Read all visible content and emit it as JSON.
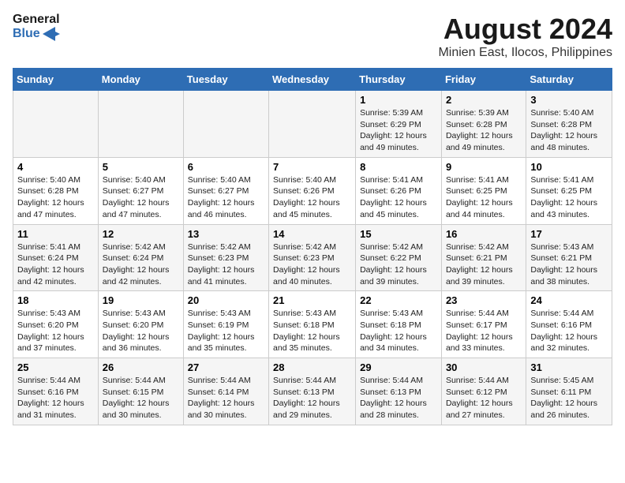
{
  "logo": {
    "text_general": "General",
    "text_blue": "Blue"
  },
  "title": "August 2024",
  "subtitle": "Minien East, Ilocos, Philippines",
  "days_of_week": [
    "Sunday",
    "Monday",
    "Tuesday",
    "Wednesday",
    "Thursday",
    "Friday",
    "Saturday"
  ],
  "weeks": [
    [
      {
        "num": "",
        "info": ""
      },
      {
        "num": "",
        "info": ""
      },
      {
        "num": "",
        "info": ""
      },
      {
        "num": "",
        "info": ""
      },
      {
        "num": "1",
        "info": "Sunrise: 5:39 AM\nSunset: 6:29 PM\nDaylight: 12 hours\nand 49 minutes."
      },
      {
        "num": "2",
        "info": "Sunrise: 5:39 AM\nSunset: 6:28 PM\nDaylight: 12 hours\nand 49 minutes."
      },
      {
        "num": "3",
        "info": "Sunrise: 5:40 AM\nSunset: 6:28 PM\nDaylight: 12 hours\nand 48 minutes."
      }
    ],
    [
      {
        "num": "4",
        "info": "Sunrise: 5:40 AM\nSunset: 6:28 PM\nDaylight: 12 hours\nand 47 minutes."
      },
      {
        "num": "5",
        "info": "Sunrise: 5:40 AM\nSunset: 6:27 PM\nDaylight: 12 hours\nand 47 minutes."
      },
      {
        "num": "6",
        "info": "Sunrise: 5:40 AM\nSunset: 6:27 PM\nDaylight: 12 hours\nand 46 minutes."
      },
      {
        "num": "7",
        "info": "Sunrise: 5:40 AM\nSunset: 6:26 PM\nDaylight: 12 hours\nand 45 minutes."
      },
      {
        "num": "8",
        "info": "Sunrise: 5:41 AM\nSunset: 6:26 PM\nDaylight: 12 hours\nand 45 minutes."
      },
      {
        "num": "9",
        "info": "Sunrise: 5:41 AM\nSunset: 6:25 PM\nDaylight: 12 hours\nand 44 minutes."
      },
      {
        "num": "10",
        "info": "Sunrise: 5:41 AM\nSunset: 6:25 PM\nDaylight: 12 hours\nand 43 minutes."
      }
    ],
    [
      {
        "num": "11",
        "info": "Sunrise: 5:41 AM\nSunset: 6:24 PM\nDaylight: 12 hours\nand 42 minutes."
      },
      {
        "num": "12",
        "info": "Sunrise: 5:42 AM\nSunset: 6:24 PM\nDaylight: 12 hours\nand 42 minutes."
      },
      {
        "num": "13",
        "info": "Sunrise: 5:42 AM\nSunset: 6:23 PM\nDaylight: 12 hours\nand 41 minutes."
      },
      {
        "num": "14",
        "info": "Sunrise: 5:42 AM\nSunset: 6:23 PM\nDaylight: 12 hours\nand 40 minutes."
      },
      {
        "num": "15",
        "info": "Sunrise: 5:42 AM\nSunset: 6:22 PM\nDaylight: 12 hours\nand 39 minutes."
      },
      {
        "num": "16",
        "info": "Sunrise: 5:42 AM\nSunset: 6:21 PM\nDaylight: 12 hours\nand 39 minutes."
      },
      {
        "num": "17",
        "info": "Sunrise: 5:43 AM\nSunset: 6:21 PM\nDaylight: 12 hours\nand 38 minutes."
      }
    ],
    [
      {
        "num": "18",
        "info": "Sunrise: 5:43 AM\nSunset: 6:20 PM\nDaylight: 12 hours\nand 37 minutes."
      },
      {
        "num": "19",
        "info": "Sunrise: 5:43 AM\nSunset: 6:20 PM\nDaylight: 12 hours\nand 36 minutes."
      },
      {
        "num": "20",
        "info": "Sunrise: 5:43 AM\nSunset: 6:19 PM\nDaylight: 12 hours\nand 35 minutes."
      },
      {
        "num": "21",
        "info": "Sunrise: 5:43 AM\nSunset: 6:18 PM\nDaylight: 12 hours\nand 35 minutes."
      },
      {
        "num": "22",
        "info": "Sunrise: 5:43 AM\nSunset: 6:18 PM\nDaylight: 12 hours\nand 34 minutes."
      },
      {
        "num": "23",
        "info": "Sunrise: 5:44 AM\nSunset: 6:17 PM\nDaylight: 12 hours\nand 33 minutes."
      },
      {
        "num": "24",
        "info": "Sunrise: 5:44 AM\nSunset: 6:16 PM\nDaylight: 12 hours\nand 32 minutes."
      }
    ],
    [
      {
        "num": "25",
        "info": "Sunrise: 5:44 AM\nSunset: 6:16 PM\nDaylight: 12 hours\nand 31 minutes."
      },
      {
        "num": "26",
        "info": "Sunrise: 5:44 AM\nSunset: 6:15 PM\nDaylight: 12 hours\nand 30 minutes."
      },
      {
        "num": "27",
        "info": "Sunrise: 5:44 AM\nSunset: 6:14 PM\nDaylight: 12 hours\nand 30 minutes."
      },
      {
        "num": "28",
        "info": "Sunrise: 5:44 AM\nSunset: 6:13 PM\nDaylight: 12 hours\nand 29 minutes."
      },
      {
        "num": "29",
        "info": "Sunrise: 5:44 AM\nSunset: 6:13 PM\nDaylight: 12 hours\nand 28 minutes."
      },
      {
        "num": "30",
        "info": "Sunrise: 5:44 AM\nSunset: 6:12 PM\nDaylight: 12 hours\nand 27 minutes."
      },
      {
        "num": "31",
        "info": "Sunrise: 5:45 AM\nSunset: 6:11 PM\nDaylight: 12 hours\nand 26 minutes."
      }
    ]
  ]
}
